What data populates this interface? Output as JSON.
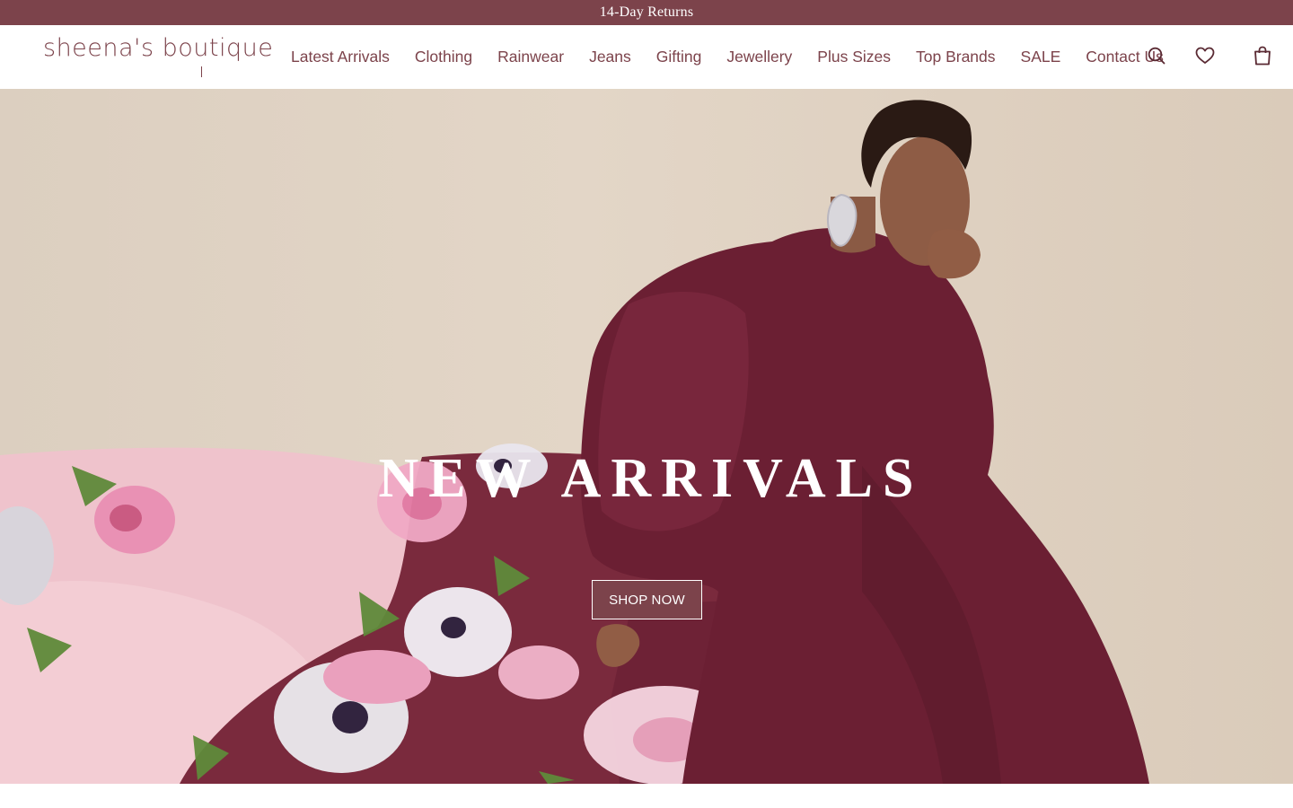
{
  "announcement": {
    "text": "14-Day Returns"
  },
  "header": {
    "logo_text": "sheena's boutique",
    "nav": [
      {
        "label": "Latest Arrivals"
      },
      {
        "label": "Clothing"
      },
      {
        "label": "Rainwear"
      },
      {
        "label": "Jeans"
      },
      {
        "label": "Gifting"
      },
      {
        "label": "Jewellery"
      },
      {
        "label": "Plus Sizes"
      },
      {
        "label": "Top Brands"
      },
      {
        "label": "SALE"
      },
      {
        "label": "Contact Us"
      }
    ],
    "icons": [
      "search-icon",
      "heart-icon",
      "shopping-bag-icon"
    ]
  },
  "hero": {
    "title": "NEW ARRIVALS",
    "button_label": "SHOP NOW"
  },
  "colors": {
    "brand": "#7c434b",
    "background": "#ffffff",
    "hero_backdrop": "#dccfc0",
    "dress": "#6b1f33",
    "sofa_pink": "#efc3cc"
  }
}
